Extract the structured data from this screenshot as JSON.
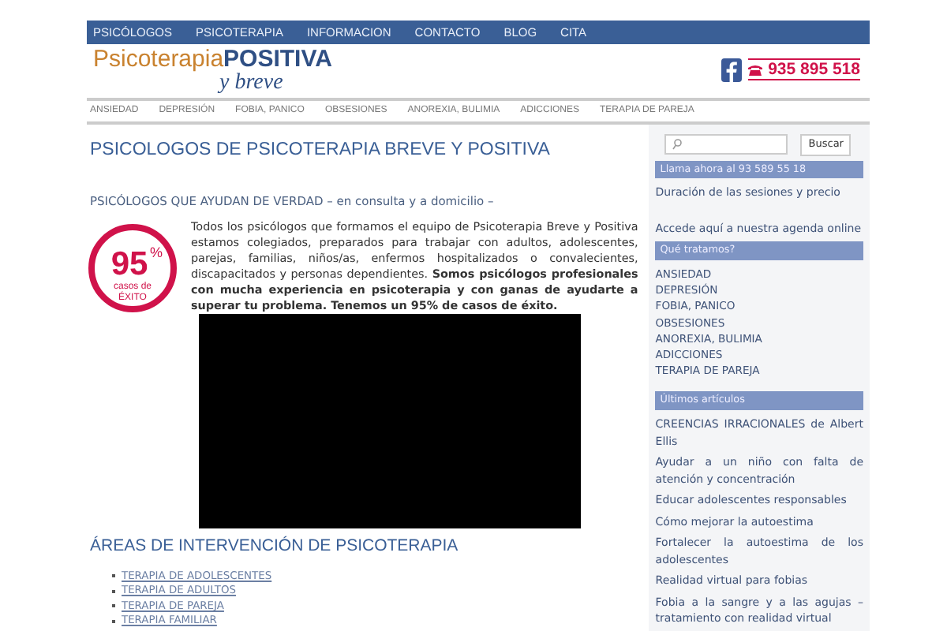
{
  "top_nav": [
    "PSICÓLOGOS",
    "PSICOTERAPIA",
    "INFORMACION",
    "CONTACTO",
    "BLOG",
    "CITA"
  ],
  "logo": {
    "part_1": "Psicoterapia",
    "part_2": "POSITIVA",
    "part_3": "y breve"
  },
  "phone": "935 895 518",
  "category_nav": [
    "ANSIEDAD",
    "DEPRESIÓN",
    "FOBIA, PANICO",
    "OBSESIONES",
    "ANOREXIA, BULIMIA",
    "ADICCIONES",
    "TERAPIA DE PAREJA"
  ],
  "page_title": "PSICOLOGOS DE PSICOTERAPIA BREVE Y POSITIVA",
  "section_heading": "PSICÓLOGOS QUE AYUDAN DE VERDAD – en consulta y a domicilio –",
  "success_badge": {
    "figure": "95",
    "unit": "%",
    "line_1": "casos de",
    "line_2": "ÉXITO"
  },
  "intro": "Todos los psicólogos que formamos el equipo de Psicoterapia Breve y Positiva estamos colegiados, preparados para trabajar con adultos, adolescentes, parejas, familias, niños/as, enfermos hospitalizados o convalecientes, discapacitados y personas dependientes. **Somos psicólogos profesionales con mucha experiencia en psicoterapia y con ganas de ayudarte a superar tu problema. Tenemos un 95% de casos de éxito.**",
  "areas": {
    "heading": "ÁREAS DE INTERVENCIÓN DE PSICOTERAPIA",
    "links": [
      "TERAPIA DE ADOLESCENTES",
      "TERAPIA DE ADULTOS",
      "TERAPIA DE PAREJA",
      "TERAPIA FAMILIAR"
    ]
  },
  "sidebar": {
    "search_button": "Buscar",
    "call_banner": "Llama ahora al 93 589 55 18",
    "links": [
      "Duración de las sesiones y precio",
      "Accede aquí a nuestra agenda online"
    ],
    "treatments": {
      "heading": "Qué tratamos?",
      "items": [
        "ANSIEDAD",
        "DEPRESIÓN",
        "FOBIA, PANICO",
        "OBSESIONES",
        "ANOREXIA, BULIMIA",
        "ADICCIONES",
        "TERAPIA DE PAREJA"
      ]
    },
    "articles": {
      "heading": "Últimos artículos",
      "items": [
        "CREENCIAS IRRACIONALES de Albert Ellis",
        "Ayudar a un niño con falta de atención y concentración",
        "Educar adolescentes responsables",
        "Cómo mejorar la autoestima",
        "Fortalecer la autoestima de los adolescentes",
        "Realidad virtual para fobias",
        "Fobia a la sangre y a las agujas – tratamiento con realidad virtual"
      ]
    }
  }
}
